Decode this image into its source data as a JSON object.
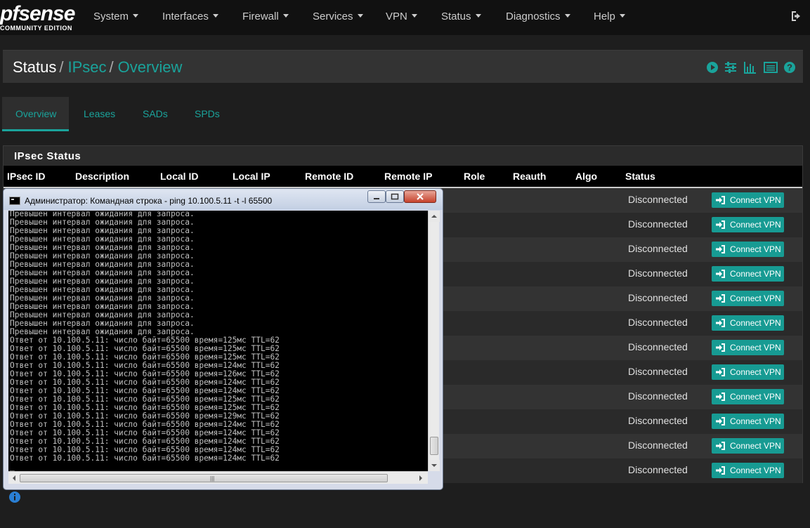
{
  "navbar": {
    "logo_main": "pfsense",
    "logo_sub": "COMMUNITY EDITION",
    "menu": [
      "System",
      "Interfaces",
      "Firewall",
      "Services",
      "VPN",
      "Status",
      "Diagnostics",
      "Help"
    ]
  },
  "breadcrumb": {
    "root": "Status",
    "level1": "IPsec",
    "level2": "Overview"
  },
  "tabs": [
    "Overview",
    "Leases",
    "SADs",
    "SPDs"
  ],
  "ipsec": {
    "title": "IPsec Status",
    "columns": [
      "IPsec ID",
      "Description",
      "Local ID",
      "Local IP",
      "Remote ID",
      "Remote IP",
      "Role",
      "Reauth",
      "Algo",
      "Status"
    ],
    "rows": [
      {
        "status": "Disconnected",
        "action": "Connect VPN"
      },
      {
        "status": "Disconnected",
        "action": "Connect VPN"
      },
      {
        "status": "Disconnected",
        "action": "Connect VPN"
      },
      {
        "status": "Disconnected",
        "action": "Connect VPN"
      },
      {
        "status": "Disconnected",
        "action": "Connect VPN"
      },
      {
        "status": "Disconnected",
        "action": "Connect VPN"
      },
      {
        "status": "Disconnected",
        "action": "Connect VPN"
      },
      {
        "status": "Disconnected",
        "action": "Connect VPN"
      },
      {
        "status": "Disconnected",
        "action": "Connect VPN"
      },
      {
        "status": "Disconnected",
        "action": "Connect VPN"
      },
      {
        "status": "Disconnected",
        "action": "Connect VPN"
      },
      {
        "status": "Disconnected",
        "action": "Connect VPN"
      }
    ]
  },
  "cmd": {
    "title": "Администратор: Командная строка - ping  10.100.5.11 -t -l 65500",
    "lines": [
      "Превышен интервал ожидания для запроса.",
      "Превышен интервал ожидания для запроса.",
      "Превышен интервал ожидания для запроса.",
      "Превышен интервал ожидания для запроса.",
      "Превышен интервал ожидания для запроса.",
      "Превышен интервал ожидания для запроса.",
      "Превышен интервал ожидания для запроса.",
      "Превышен интервал ожидания для запроса.",
      "Превышен интервал ожидания для запроса.",
      "Превышен интервал ожидания для запроса.",
      "Превышен интервал ожидания для запроса.",
      "Превышен интервал ожидания для запроса.",
      "Превышен интервал ожидания для запроса.",
      "Превышен интервал ожидания для запроса.",
      "Превышен интервал ожидания для запроса.",
      "Ответ от 10.100.5.11: число байт=65500 время=125мс TTL=62",
      "Ответ от 10.100.5.11: число байт=65500 время=125мс TTL=62",
      "Ответ от 10.100.5.11: число байт=65500 время=125мс TTL=62",
      "Ответ от 10.100.5.11: число байт=65500 время=124мс TTL=62",
      "Ответ от 10.100.5.11: число байт=65500 время=126мс TTL=62",
      "Ответ от 10.100.5.11: число байт=65500 время=124мс TTL=62",
      "Ответ от 10.100.5.11: число байт=65500 время=124мс TTL=62",
      "Ответ от 10.100.5.11: число байт=65500 время=125мс TTL=62",
      "Ответ от 10.100.5.11: число байт=65500 время=125мс TTL=62",
      "Ответ от 10.100.5.11: число байт=65500 время=129мс TTL=62",
      "Ответ от 10.100.5.11: число байт=65500 время=124мс TTL=62",
      "Ответ от 10.100.5.11: число байт=65500 время=124мс TTL=62",
      "Ответ от 10.100.5.11: число байт=65500 время=124мс TTL=62",
      "Ответ от 10.100.5.11: число байт=65500 время=124мс TTL=62",
      "Ответ от 10.100.5.11: число байт=65500 время=124мс TTL=62",
      "_"
    ]
  },
  "colors": {
    "accent": "#1aa39b",
    "navbar_bg": "#111111",
    "panel_bg": "#333333",
    "button_bg": "#179b93"
  },
  "icons": [
    "play-icon",
    "sliders-icon",
    "chart-icon",
    "list-icon",
    "help-icon",
    "logout-icon",
    "sign-in-icon",
    "info-icon"
  ]
}
